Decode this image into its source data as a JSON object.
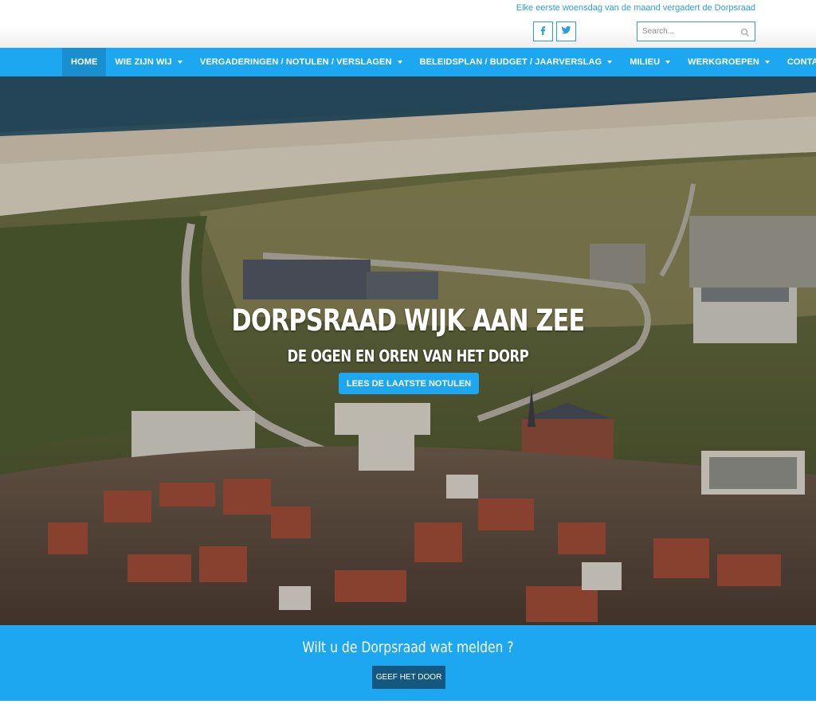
{
  "header": {
    "tagline": "Elke eerste woensdag van de maand vergadert de Dorpsraad",
    "social": [
      {
        "name": "facebook-icon"
      },
      {
        "name": "twitter-icon"
      }
    ],
    "search": {
      "placeholder": "Search..."
    }
  },
  "nav": {
    "items": [
      {
        "label": "HOME",
        "active": true,
        "dropdown": false
      },
      {
        "label": "WIE ZIJN WIJ",
        "active": false,
        "dropdown": true
      },
      {
        "label": "VERGADERINGEN / NOTULEN / VERSLAGEN",
        "active": false,
        "dropdown": true
      },
      {
        "label": "BELEIDSPLAN / BUDGET / JAARVERSLAG",
        "active": false,
        "dropdown": true
      },
      {
        "label": "MILIEU",
        "active": false,
        "dropdown": true
      },
      {
        "label": "WERKGROEPEN",
        "active": false,
        "dropdown": true
      },
      {
        "label": "CONTACT",
        "active": false,
        "dropdown": false
      }
    ]
  },
  "hero": {
    "title": "DORPSRAAD WIJK AAN ZEE",
    "subtitle": "DE OGEN EN OREN VAN HET DORP",
    "button_label": "LEES DE LAATSTE NOTULEN"
  },
  "band": {
    "text": "Wilt u de Dorpsraad wat melden ?",
    "button_label": "GEEF HET DOOR"
  },
  "colors": {
    "accent": "#1ea7f1",
    "nav_active": "#1a8fd0",
    "dark_button": "#14577f",
    "tagline": "#2a9fd8"
  }
}
